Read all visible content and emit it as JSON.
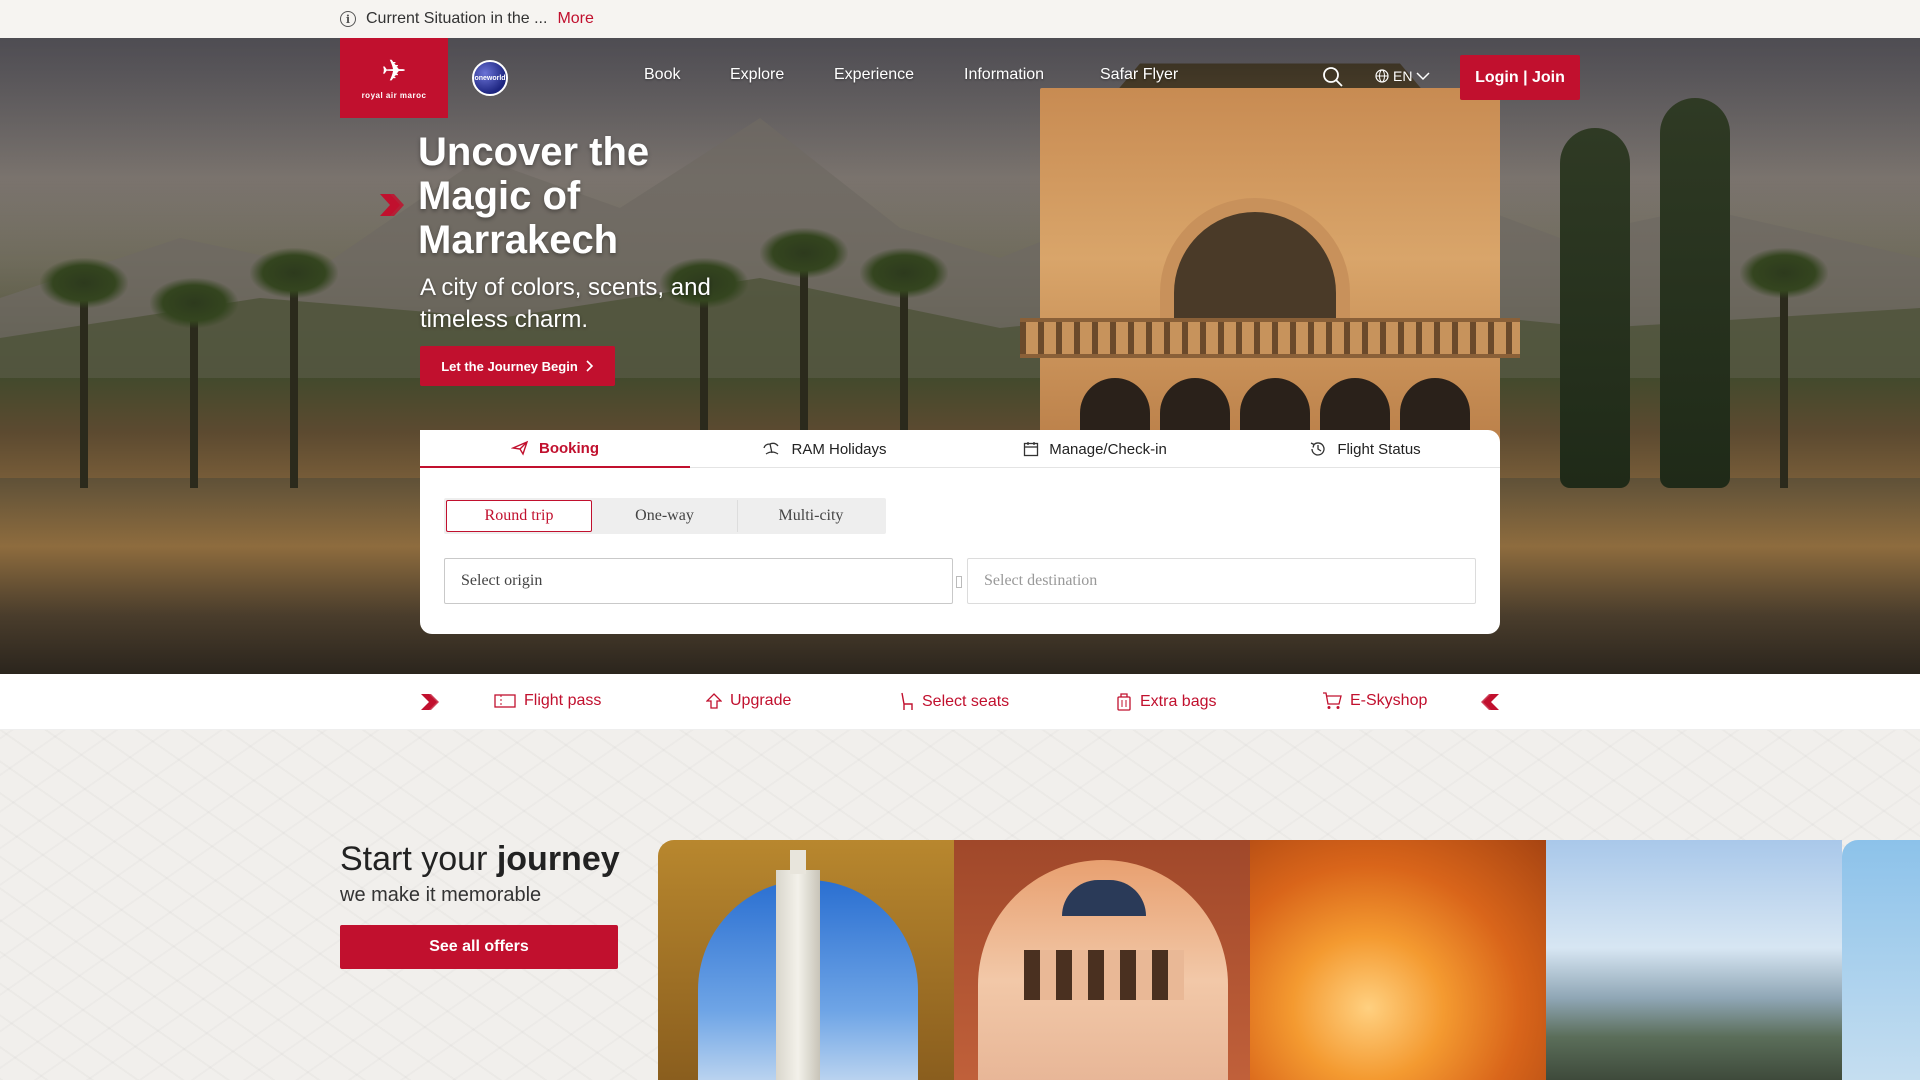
{
  "topbar": {
    "notice": "Current Situation in the ...",
    "more": "More"
  },
  "header": {
    "logo_emblem": "✈",
    "logo_text": "royal air maroc",
    "alliance": "oneworld",
    "nav": [
      "Book",
      "Explore",
      "Experience",
      "Information",
      "Safar Flyer"
    ],
    "language": "EN",
    "login": "Login | Join"
  },
  "hero": {
    "title": "Uncover the Magic of Marrakech",
    "subtitle": "A city of colors, scents, and timeless charm.",
    "cta": "Let the Journey Begin"
  },
  "booking": {
    "tabs": [
      {
        "label": "Booking",
        "icon": "plane-icon",
        "active": true
      },
      {
        "label": "RAM Holidays",
        "icon": "beach-icon",
        "active": false
      },
      {
        "label": "Manage/Check-in",
        "icon": "calendar-icon",
        "active": false
      },
      {
        "label": "Flight Status",
        "icon": "history-icon",
        "active": false
      }
    ],
    "trip_types": [
      "Round trip",
      "One-way",
      "Multi-city"
    ],
    "selected_trip": "Round trip",
    "origin_placeholder": "Select origin",
    "destination_placeholder": "Select destination"
  },
  "quick_links": [
    {
      "label": "Flight pass",
      "icon": "ticket-icon"
    },
    {
      "label": "Upgrade",
      "icon": "upgrade-icon"
    },
    {
      "label": "Select seats",
      "icon": "seat-icon"
    },
    {
      "label": "Extra bags",
      "icon": "luggage-icon"
    },
    {
      "label": "E-Skyshop",
      "icon": "cart-icon"
    }
  ],
  "journey": {
    "title_plain": "Start your ",
    "title_bold": "journey",
    "subtitle": "we make it memorable",
    "cta": "See all offers"
  },
  "colors": {
    "brand_red": "#c1102e",
    "white": "#ffffff"
  }
}
